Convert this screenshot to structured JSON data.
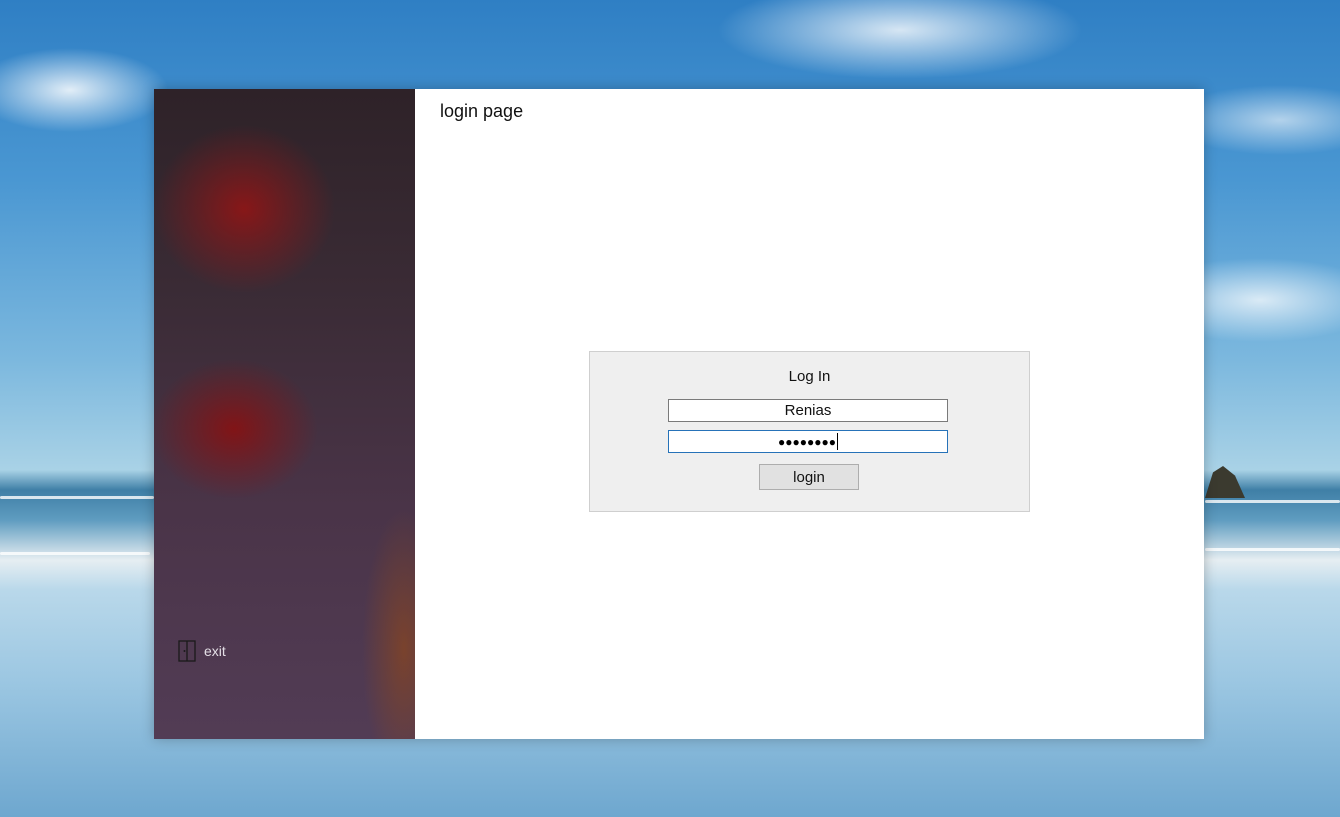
{
  "window": {
    "title": "login page"
  },
  "sidebar": {
    "exit_label": "exit",
    "exit_icon": "exit-door-icon"
  },
  "login_form": {
    "heading": "Log In",
    "username_value": "Renias",
    "password_masked": "●●●●●●●●",
    "password_length": 8,
    "submit_label": "login"
  },
  "colors": {
    "sidebar_background": "#3a2b35",
    "main_background": "#ffffff",
    "form_background": "#efefef",
    "focus_border": "#2672b8"
  }
}
